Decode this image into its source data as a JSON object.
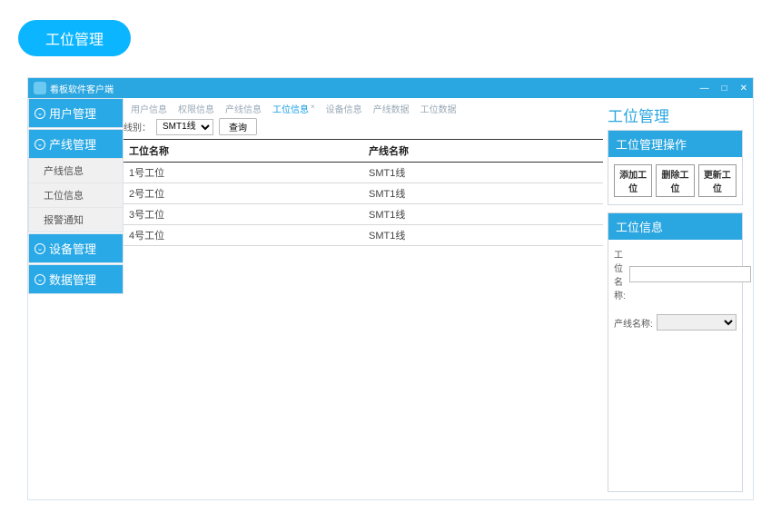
{
  "top_pill": "工位管理",
  "window_title": "看板软件客户端",
  "menubar": {
    "items": [
      "用户信息",
      "权限信息",
      "产线信息",
      "工位信息",
      "设备信息",
      "产线数据",
      "工位数据"
    ],
    "active": "工位信息"
  },
  "sidebar": [
    {
      "title": "用户管理",
      "items": []
    },
    {
      "title": "产线管理",
      "items": [
        "产线信息",
        "工位信息",
        "报警通知"
      ]
    },
    {
      "title": "设备管理",
      "items": []
    },
    {
      "title": "数据管理",
      "items": []
    }
  ],
  "filter": {
    "label": "线别：",
    "selected": "SMT1线",
    "btn": "查询"
  },
  "table": {
    "headers": [
      "工位名称",
      "产线名称"
    ],
    "rows": [
      [
        "1号工位",
        "SMT1线"
      ],
      [
        "2号工位",
        "SMT1线"
      ],
      [
        "3号工位",
        "SMT1线"
      ],
      [
        "4号工位",
        "SMT1线"
      ]
    ]
  },
  "right": {
    "title": "工位管理",
    "ops_title": "工位管理操作",
    "buttons": [
      "添加工位",
      "删除工位",
      "更新工位"
    ],
    "info_title": "工位信息",
    "fields": [
      {
        "label": "工位名称:"
      },
      {
        "label": "产线名称:"
      }
    ]
  }
}
